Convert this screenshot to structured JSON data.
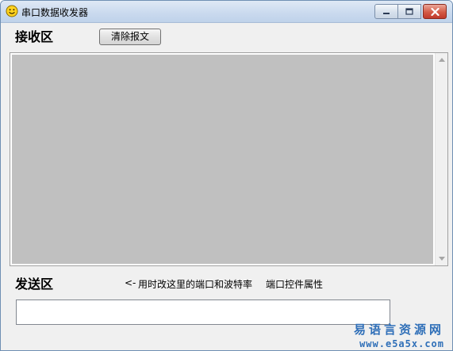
{
  "window": {
    "title": "串口数据收发器"
  },
  "receive": {
    "label": "接收区",
    "clear_button": "清除报文",
    "content": ""
  },
  "send": {
    "label": "发送区",
    "hint_arrow": "<-",
    "hint_text": "用时改这里的端口和波特率",
    "hint_text2": "端口控件属性",
    "input_value": "",
    "input_placeholder": ""
  },
  "watermark": {
    "brand": "易语言资源网",
    "url": "www.e5a5x.com"
  },
  "colors": {
    "receive_bg": "#c0c0c0",
    "window_bg": "#f0f0f0",
    "watermark": "#2f6fb8"
  },
  "icons": {
    "app": "smiley-icon",
    "minimize": "minimize-icon",
    "maximize": "maximize-icon",
    "close": "close-icon"
  }
}
